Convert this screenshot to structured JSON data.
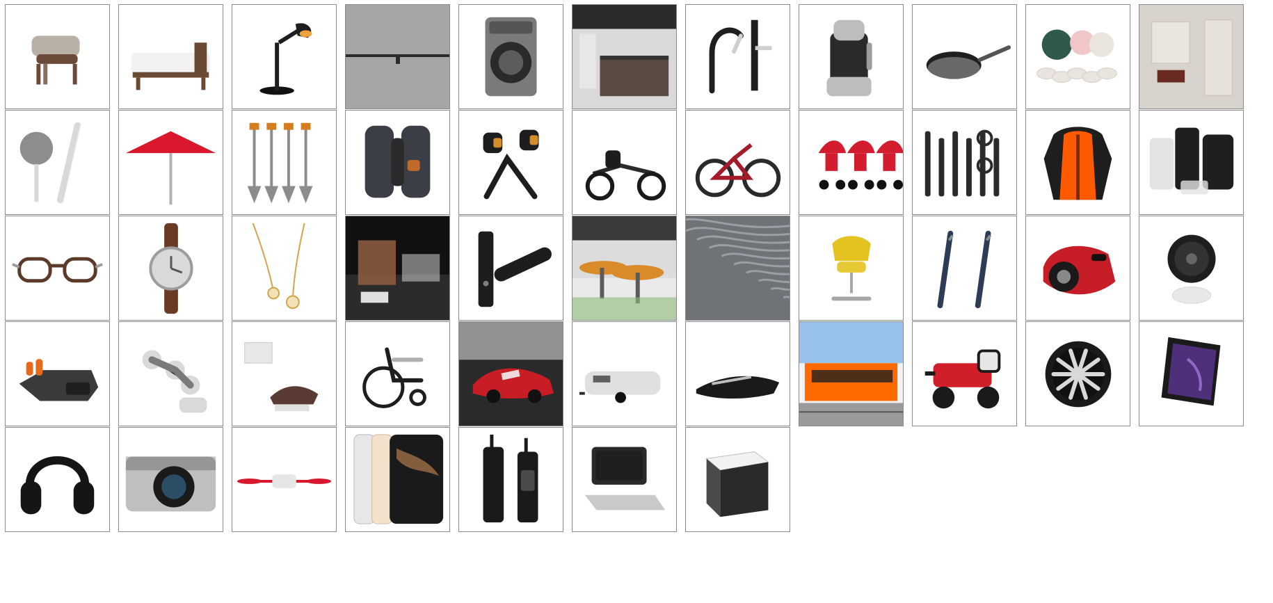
{
  "tiles": [
    {
      "icon": "lounge-chair-icon",
      "colors": {
        "main": "#6b4a3a",
        "accent": "#b9b1a7"
      }
    },
    {
      "icon": "bed-icon",
      "colors": {
        "main": "#6a4a33",
        "accent": "#f2f2f2"
      }
    },
    {
      "icon": "desk-lamp-icon",
      "colors": {
        "main": "#1e1e1e",
        "accent": "#f0a13a"
      }
    },
    {
      "icon": "track-light-icon",
      "colors": {
        "main": "#9a9a9a",
        "accent": "#2a2a2a"
      }
    },
    {
      "icon": "washing-machine-icon",
      "colors": {
        "main": "#7a7a7a",
        "accent": "#2b2b2b"
      }
    },
    {
      "icon": "kitchen-island-icon",
      "colors": {
        "main": "#5a4a44",
        "accent": "#d9d9d9"
      }
    },
    {
      "icon": "faucet-icon",
      "colors": {
        "main": "#1e1e1e",
        "accent": "#cfcfcf"
      }
    },
    {
      "icon": "blender-icon",
      "colors": {
        "main": "#bdbdbd",
        "accent": "#2a2a2a"
      }
    },
    {
      "icon": "frying-pan-icon",
      "colors": {
        "main": "#1f1f1f",
        "accent": "#d9d9d9"
      }
    },
    {
      "icon": "dinnerware-icon",
      "colors": {
        "main": "#2f5a4b",
        "accent": "#f0c6c9"
      }
    },
    {
      "icon": "bathroom-icon",
      "colors": {
        "main": "#bfb7ad",
        "accent": "#6a2b25"
      }
    },
    {
      "icon": "shower-head-icon",
      "colors": {
        "main": "#d9d9d9",
        "accent": "#8d8d8d"
      }
    },
    {
      "icon": "umbrella-icon",
      "colors": {
        "main": "#d9172d",
        "accent": "#b0b0b0"
      }
    },
    {
      "icon": "shovel-icon",
      "colors": {
        "main": "#8c8c8c",
        "accent": "#d67d1f"
      }
    },
    {
      "icon": "binoculars-icon",
      "colors": {
        "main": "#3b3f45",
        "accent": "#c26a2b"
      }
    },
    {
      "icon": "dumbbell-icon",
      "colors": {
        "main": "#1d1d1d",
        "accent": "#d58c2a"
      }
    },
    {
      "icon": "go-kart-icon",
      "colors": {
        "main": "#d9d9d9",
        "accent": "#1a1a1a"
      }
    },
    {
      "icon": "mountain-bike-icon",
      "colors": {
        "main": "#2a2a2a",
        "accent": "#a31b2a"
      }
    },
    {
      "icon": "stroller-icon",
      "colors": {
        "main": "#d31d2f",
        "accent": "#ffffff"
      }
    },
    {
      "icon": "grooming-kit-icon",
      "colors": {
        "main": "#2a2a2a",
        "accent": "#8c8c8c"
      }
    },
    {
      "icon": "jacket-icon",
      "colors": {
        "main": "#1e1e1e",
        "accent": "#ff5a00"
      }
    },
    {
      "icon": "luggage-icon",
      "colors": {
        "main": "#1f1f1f",
        "accent": "#e3e3e3"
      }
    },
    {
      "icon": "glasses-icon",
      "colors": {
        "main": "#5b3a2a",
        "accent": "#9b9b9b"
      }
    },
    {
      "icon": "wristwatch-icon",
      "colors": {
        "main": "#6a3a24",
        "accent": "#d9d9d9"
      }
    },
    {
      "icon": "necklace-icon",
      "colors": {
        "main": "#d2a44a",
        "accent": "#f2e2b8"
      }
    },
    {
      "icon": "interior-icon",
      "colors": {
        "main": "#2a2a2a",
        "accent": "#8b5b3f"
      }
    },
    {
      "icon": "door-handle-icon",
      "colors": {
        "main": "#1d1d1d",
        "accent": "#7d7d7d"
      }
    },
    {
      "icon": "plaza-icon",
      "colors": {
        "main": "#d98b2a",
        "accent": "#8dbb7a"
      }
    },
    {
      "icon": "marble-icon",
      "colors": {
        "main": "#6f7378",
        "accent": "#b8bcc2"
      }
    },
    {
      "icon": "office-chair-icon",
      "colors": {
        "main": "#e4c21f",
        "accent": "#a7a7a7"
      }
    },
    {
      "icon": "pen-icon",
      "colors": {
        "main": "#2d3c56",
        "accent": "#8d8d8d"
      }
    },
    {
      "icon": "circular-saw-icon",
      "colors": {
        "main": "#c61d26",
        "accent": "#1a1a1a"
      }
    },
    {
      "icon": "fan-icon",
      "colors": {
        "main": "#1e1e1e",
        "accent": "#e8e8e8"
      }
    },
    {
      "icon": "control-panel-icon",
      "colors": {
        "main": "#3a3a3a",
        "accent": "#e46a1e"
      }
    },
    {
      "icon": "robot-arm-icon",
      "colors": {
        "main": "#d9d9d9",
        "accent": "#7a7a7a"
      }
    },
    {
      "icon": "dental-chair-icon",
      "colors": {
        "main": "#5a3b33",
        "accent": "#e0e0e0"
      }
    },
    {
      "icon": "wheelchair-icon",
      "colors": {
        "main": "#1e1e1e",
        "accent": "#b0b0b0"
      }
    },
    {
      "icon": "sports-car-icon",
      "colors": {
        "main": "#c81d25",
        "accent": "#f2f2f2"
      }
    },
    {
      "icon": "trailer-icon",
      "colors": {
        "main": "#e0e0e0",
        "accent": "#2a2a2a"
      }
    },
    {
      "icon": "jet-boat-icon",
      "colors": {
        "main": "#1a1a1a",
        "accent": "#e8e8e8"
      }
    },
    {
      "icon": "tram-icon",
      "colors": {
        "main": "#ff6a00",
        "accent": "#7fb7e8"
      }
    },
    {
      "icon": "sprayer-tractor-icon",
      "colors": {
        "main": "#d11f2a",
        "accent": "#1a1a1a"
      }
    },
    {
      "icon": "alloy-wheel-icon",
      "colors": {
        "main": "#1a1a1a",
        "accent": "#d9d9d9"
      }
    },
    {
      "icon": "tv-icon",
      "colors": {
        "main": "#1a1a1a",
        "accent": "#4d2f7a"
      }
    },
    {
      "icon": "headphones-icon",
      "colors": {
        "main": "#151515",
        "accent": "#3a3a3a"
      }
    },
    {
      "icon": "camera-icon",
      "colors": {
        "main": "#1a1a1a",
        "accent": "#bfbfbf"
      }
    },
    {
      "icon": "drone-icon",
      "colors": {
        "main": "#d9172d",
        "accent": "#e6e6e6"
      }
    },
    {
      "icon": "smartphone-icon",
      "colors": {
        "main": "#1a1a1a",
        "accent": "#b07a4b"
      }
    },
    {
      "icon": "walkie-talkie-icon",
      "colors": {
        "main": "#1a1a1a",
        "accent": "#6d6d6d"
      }
    },
    {
      "icon": "laptop-icon",
      "colors": {
        "main": "#2a2a2a",
        "accent": "#c9c9c9"
      }
    },
    {
      "icon": "product-box-icon",
      "colors": {
        "main": "#2a2a2a",
        "accent": "#f2f2f2"
      }
    }
  ]
}
